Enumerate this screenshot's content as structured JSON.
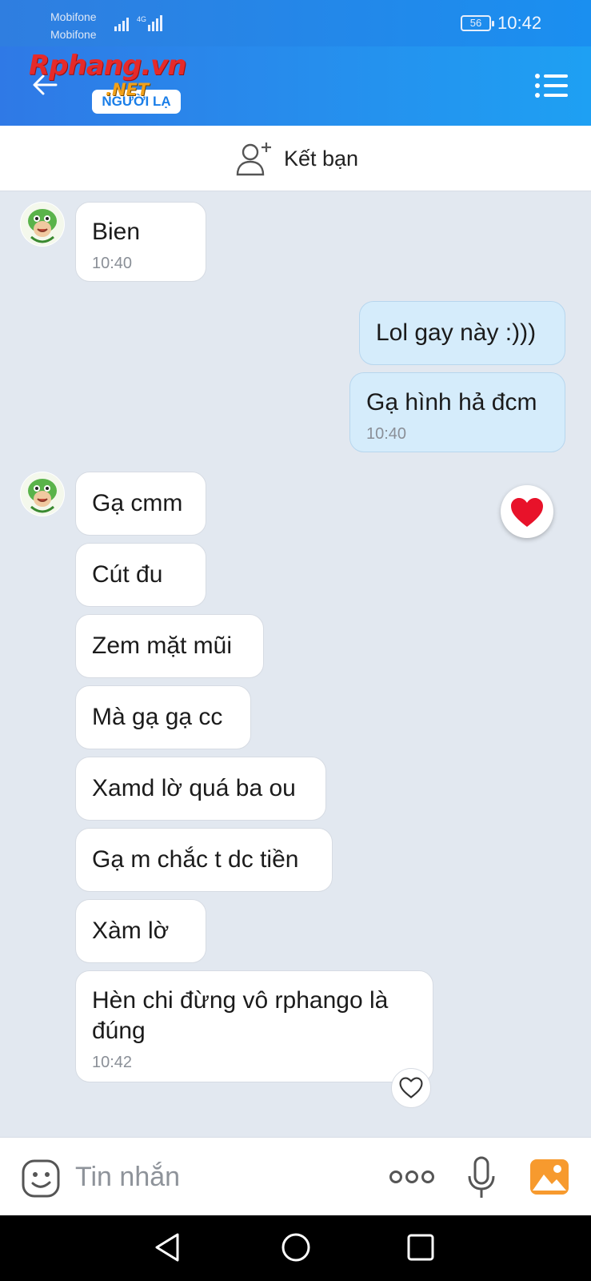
{
  "status_bar": {
    "carrier_1": "Mobifone",
    "carrier_2": "Mobifone",
    "network": "4G",
    "battery": "56",
    "time": "10:42"
  },
  "header": {
    "watermark_main": "Rphang.vn",
    "watermark_sub": ".NET",
    "stranger_badge": "NGƯỜI LẠ",
    "back_icon": "arrow-left-icon",
    "menu_icon": "list-menu-icon"
  },
  "add_friend": {
    "label": "Kết bạn",
    "icon": "add-user-icon"
  },
  "messages": [
    {
      "dir": "in",
      "text": "Bien",
      "time": "10:40"
    },
    {
      "dir": "out",
      "text": "Lol gay này :)))"
    },
    {
      "dir": "out",
      "text": "Gạ hình hả đcm",
      "time": "10:40"
    },
    {
      "dir": "in",
      "text": "Gạ cmm"
    },
    {
      "dir": "in",
      "text": "Cút đu"
    },
    {
      "dir": "in",
      "text": "Zem mặt mũi"
    },
    {
      "dir": "in",
      "text": "Mà gạ gạ cc"
    },
    {
      "dir": "in",
      "text": "Xamd lờ quá ba ou"
    },
    {
      "dir": "in",
      "text": "Gạ m chắc t dc tiền"
    },
    {
      "dir": "in",
      "text": "Xàm lờ"
    },
    {
      "dir": "in",
      "text": "Hèn chi đừng vô rphango là đúng",
      "time": "10:42"
    }
  ],
  "reaction": {
    "icon": "red-heart-icon"
  },
  "like_button": {
    "icon": "heart-outline-icon"
  },
  "input_bar": {
    "placeholder": "Tin nhắn",
    "emoji_icon": "emoji-icon",
    "more_icon": "more-dots-icon",
    "mic_icon": "microphone-icon",
    "photo_icon": "photo-icon"
  },
  "colors": {
    "header_start": "#2f79e6",
    "header_end": "#1ea0f3",
    "outgoing_bubble": "#d5ecfb",
    "incoming_bubble": "#ffffff",
    "chat_background": "#e2e8f0"
  }
}
